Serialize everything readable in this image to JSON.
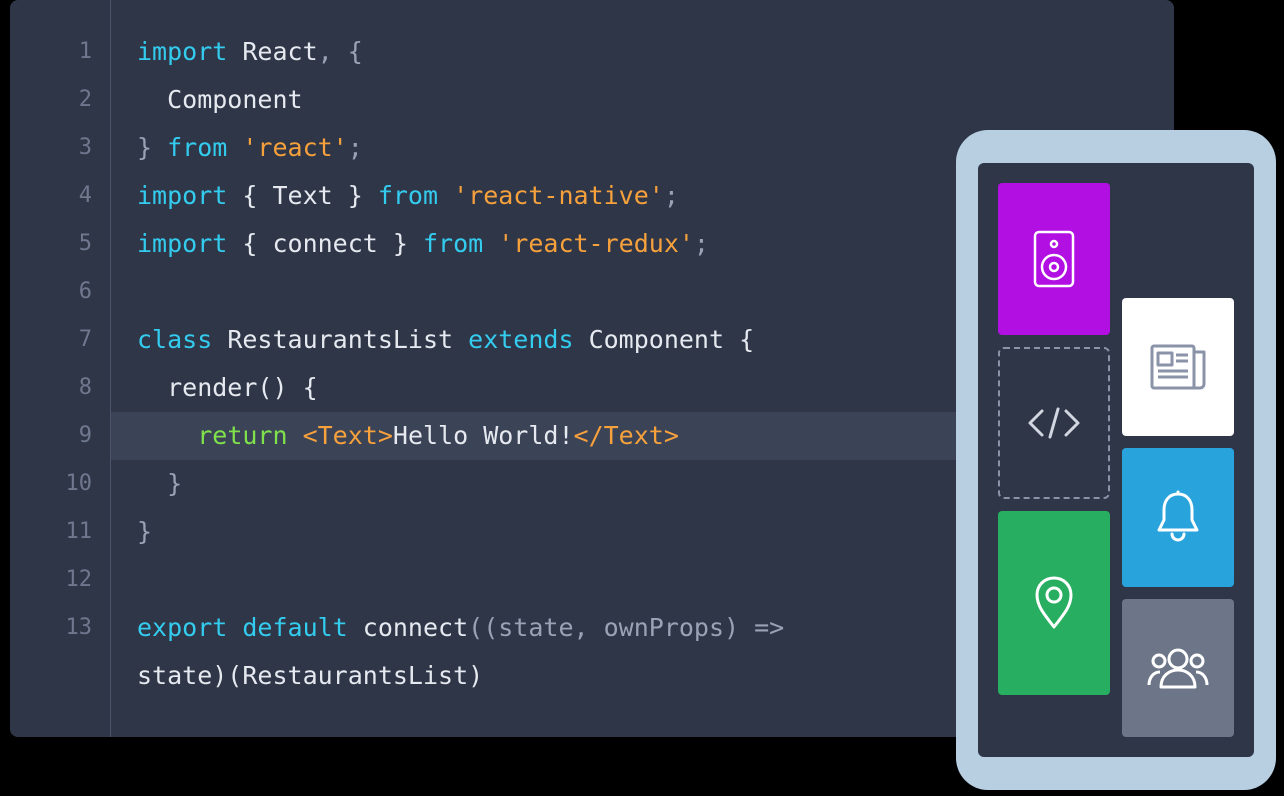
{
  "editor": {
    "lineNumbers": [
      "1",
      "2",
      "3",
      "4",
      "5",
      "6",
      "7",
      "8",
      "9",
      "10",
      "11",
      "12",
      "13",
      ""
    ],
    "lines": {
      "l1": {
        "a": "import ",
        "b": "React",
        "c": ", {"
      },
      "l2": {
        "a": "  Component"
      },
      "l3": {
        "a": "} ",
        "b": "from ",
        "c": "'react'",
        "d": ";"
      },
      "l4": {
        "a": "import ",
        "b": "{ Text } ",
        "c": "from ",
        "d": "'react-native'",
        "e": ";"
      },
      "l5": {
        "a": "import ",
        "b": "{ connect } ",
        "c": "from ",
        "d": "'react-redux'",
        "e": ";"
      },
      "l7": {
        "a": "class ",
        "b": "RestaurantsList ",
        "c": "extends ",
        "d": "Component {"
      },
      "l8": {
        "a": "  render() {"
      },
      "l9": {
        "a": "    ",
        "b": "return ",
        "c": "<Text>",
        "d": "Hello World!",
        "e": "</Text>"
      },
      "l10": {
        "a": "  }"
      },
      "l11": {
        "a": "}"
      },
      "l13a": {
        "a": "export default ",
        "b": "connect",
        "c": "((state, ownProps) =>"
      },
      "l13b": {
        "a": "state)(RestaurantsList)"
      }
    }
  },
  "phone": {
    "tiles": {
      "speaker": "speaker-icon",
      "code": "code-icon",
      "pin": "location-pin-icon",
      "news": "newspaper-icon",
      "bell": "bell-icon",
      "people": "people-icon"
    }
  },
  "colors": {
    "editorBg": "#2e3648",
    "phoneBody": "#b8cfe2",
    "magenta": "#b20fe3",
    "green": "#27ae60",
    "blue": "#29a3dc",
    "gray": "#6d7689"
  }
}
